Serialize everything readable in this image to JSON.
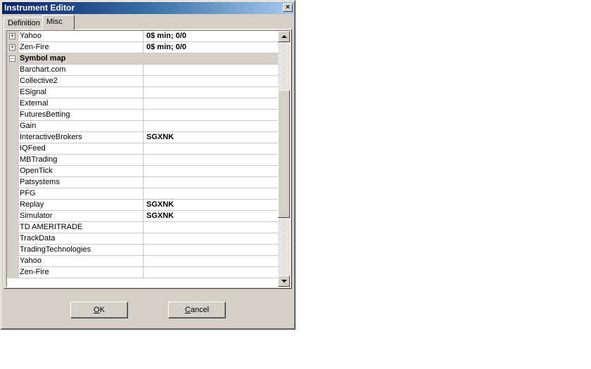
{
  "window": {
    "title": "Instrument Editor",
    "close_glyph": "×"
  },
  "tabs": [
    {
      "label": "Definition",
      "active": false
    },
    {
      "label": "Misc",
      "active": true
    }
  ],
  "grid": {
    "rows": [
      {
        "type": "item",
        "expander": "+",
        "name": "Yahoo",
        "value": "0$ min;  0/0"
      },
      {
        "type": "item",
        "expander": "+",
        "name": "Zen-Fire",
        "value": "0$ min;  0/0"
      },
      {
        "type": "category",
        "expander": "−",
        "name": "Symbol map",
        "value": ""
      },
      {
        "type": "item",
        "name": "Barchart.com",
        "value": ""
      },
      {
        "type": "item",
        "name": "Collective2",
        "value": ""
      },
      {
        "type": "item",
        "name": "ESignal",
        "value": ""
      },
      {
        "type": "item",
        "name": "External",
        "value": ""
      },
      {
        "type": "item",
        "name": "FuturesBetting",
        "value": ""
      },
      {
        "type": "item",
        "name": "Gain",
        "value": ""
      },
      {
        "type": "item",
        "name": "InteractiveBrokers",
        "value": "SGXNK"
      },
      {
        "type": "item",
        "name": "IQFeed",
        "value": ""
      },
      {
        "type": "item",
        "name": "MBTrading",
        "value": ""
      },
      {
        "type": "item",
        "name": "OpenTick",
        "value": ""
      },
      {
        "type": "item",
        "name": "Patsystems",
        "value": ""
      },
      {
        "type": "item",
        "name": "PFG",
        "value": ""
      },
      {
        "type": "item",
        "name": "Replay",
        "value": "SGXNK"
      },
      {
        "type": "item",
        "name": "Simulator",
        "value": "SGXNK"
      },
      {
        "type": "item",
        "name": "TD AMERITRADE",
        "value": ""
      },
      {
        "type": "item",
        "name": "TrackData",
        "value": ""
      },
      {
        "type": "item",
        "name": "TradingTechnologies",
        "value": ""
      },
      {
        "type": "item",
        "name": "Yahoo",
        "value": ""
      },
      {
        "type": "item",
        "name": "Zen-Fire",
        "value": ""
      }
    ],
    "scroll_position": 0.45
  },
  "buttons": {
    "ok": {
      "mnemonic": "O",
      "rest": "K"
    },
    "cancel": {
      "mnemonic": "C",
      "rest": "ancel"
    }
  }
}
